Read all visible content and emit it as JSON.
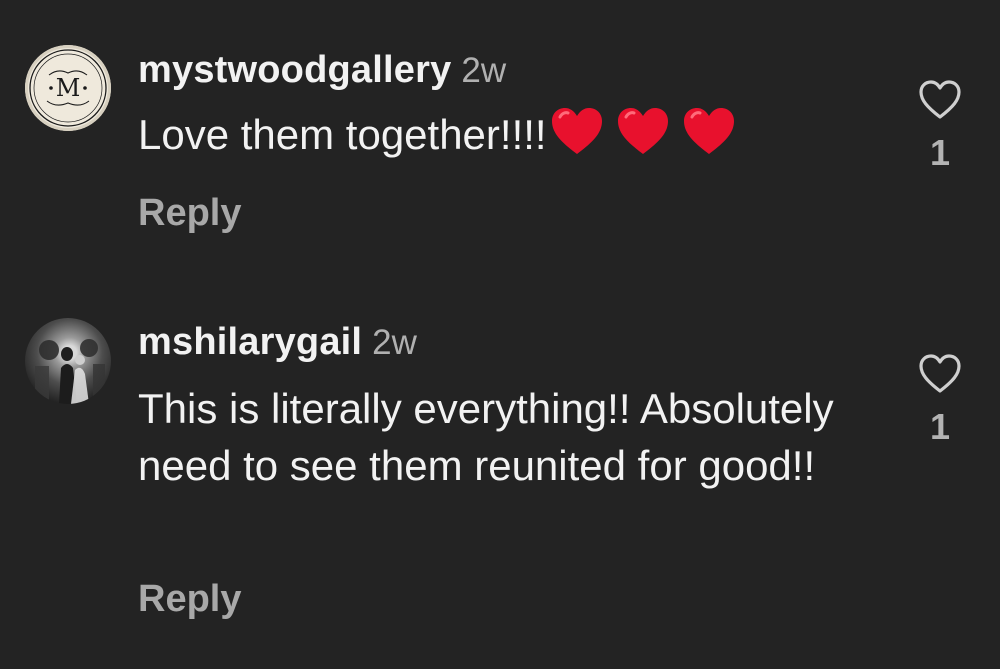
{
  "comments": [
    {
      "username": "mystwoodgallery",
      "time": "2w",
      "text": "Love them together!!!!",
      "emojis": [
        "red-heart",
        "red-heart",
        "red-heart"
      ],
      "reply_label": "Reply",
      "like_count": "1",
      "avatar": {
        "type": "logo",
        "monogram": "M"
      }
    },
    {
      "username": "mshilarygail",
      "time": "2w",
      "text": "This is literally everything!! Absolutely need to see them reunited for good!!",
      "reply_label": "Reply",
      "like_count": "1",
      "avatar": {
        "type": "photo"
      }
    }
  ],
  "colors": {
    "background": "#232323",
    "primary_text": "#f2f2f2",
    "secondary_text": "#a8a8a8",
    "heart": "#e8112d"
  },
  "icons": {
    "like": "heart-outline-icon",
    "emoji": "red-heart-emoji"
  }
}
